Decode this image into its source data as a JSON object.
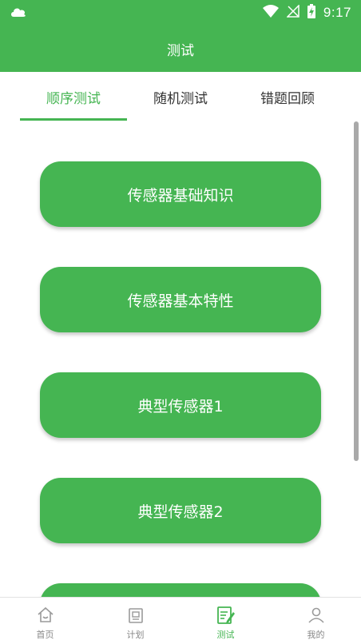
{
  "status_bar": {
    "time": "9:17",
    "icons": [
      "cloud-icon",
      "wifi-icon",
      "no-signal-icon",
      "battery-charging-icon"
    ]
  },
  "app_bar": {
    "title": "测试"
  },
  "tabs": [
    {
      "label": "顺序测试",
      "active": true
    },
    {
      "label": "随机测试",
      "active": false
    },
    {
      "label": "错题回顾",
      "active": false
    }
  ],
  "topics": [
    {
      "label": "传感器基础知识"
    },
    {
      "label": "传感器基本特性"
    },
    {
      "label": "典型传感器1"
    },
    {
      "label": "典型传感器2"
    },
    {
      "label": ""
    }
  ],
  "bottom_nav": [
    {
      "label": "首页",
      "icon": "home-icon",
      "active": false
    },
    {
      "label": "计划",
      "icon": "plan-icon",
      "active": false
    },
    {
      "label": "测试",
      "icon": "test-edit-icon",
      "active": true
    },
    {
      "label": "我的",
      "icon": "profile-icon",
      "active": false
    }
  ],
  "colors": {
    "primary": "#45b552",
    "inactive_text": "#888888",
    "tab_text": "#333333"
  }
}
